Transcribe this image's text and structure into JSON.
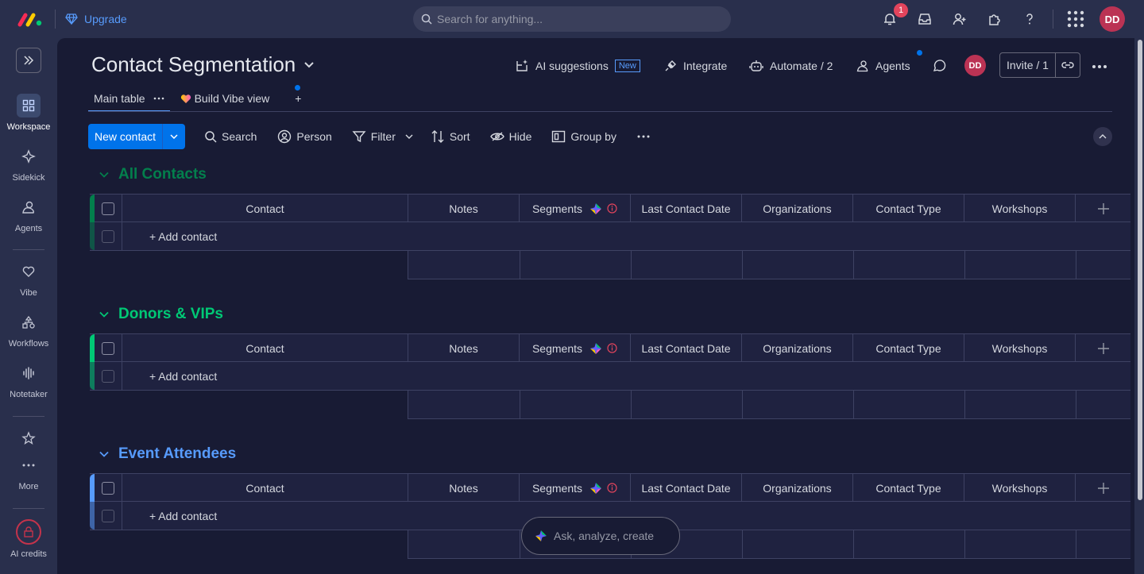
{
  "topbar": {
    "upgrade_label": "Upgrade",
    "search_placeholder": "Search for anything...",
    "notification_count": "1",
    "user_initials": "DD"
  },
  "sidebar": {
    "items": [
      {
        "label": "Workspace",
        "icon": "grid-icon",
        "active": true
      },
      {
        "label": "Sidekick",
        "icon": "sparkle-icon"
      },
      {
        "label": "Agents",
        "icon": "agents-icon"
      },
      {
        "label": "Vibe",
        "icon": "heart-icon"
      },
      {
        "label": "Workflows",
        "icon": "workflow-icon"
      },
      {
        "label": "Notetaker",
        "icon": "waveform-icon"
      },
      {
        "label": "More",
        "icon": "more-icon"
      },
      {
        "label": "AI credits",
        "icon": "lock-icon"
      }
    ]
  },
  "board": {
    "title": "Contact Segmentation",
    "actions": {
      "ai_suggestions": "AI suggestions",
      "new_tag": "New",
      "integrate": "Integrate",
      "automate": "Automate / 2",
      "agents": "Agents",
      "invite": "Invite / 1"
    },
    "avatar_initials": "DD",
    "tabs": [
      {
        "label": "Main table"
      },
      {
        "label": "Build Vibe view"
      }
    ],
    "add_tab": "+"
  },
  "toolbar": {
    "new_item": "New contact",
    "search": "Search",
    "person": "Person",
    "filter": "Filter",
    "sort": "Sort",
    "hide": "Hide",
    "group_by": "Group by"
  },
  "columns": [
    "Contact",
    "Notes",
    "Segments",
    "Last Contact Date",
    "Organizations",
    "Contact Type",
    "Workshops"
  ],
  "groups": [
    {
      "title": "All Contacts",
      "color": "#037f4c",
      "add_label": "+ Add contact"
    },
    {
      "title": "Donors & VIPs",
      "color": "#00c875",
      "add_label": "+ Add contact"
    },
    {
      "title": "Event Attendees",
      "color": "#579bfc",
      "add_label": "+ Add contact"
    }
  ],
  "askbar": {
    "placeholder": "Ask, analyze, create"
  }
}
